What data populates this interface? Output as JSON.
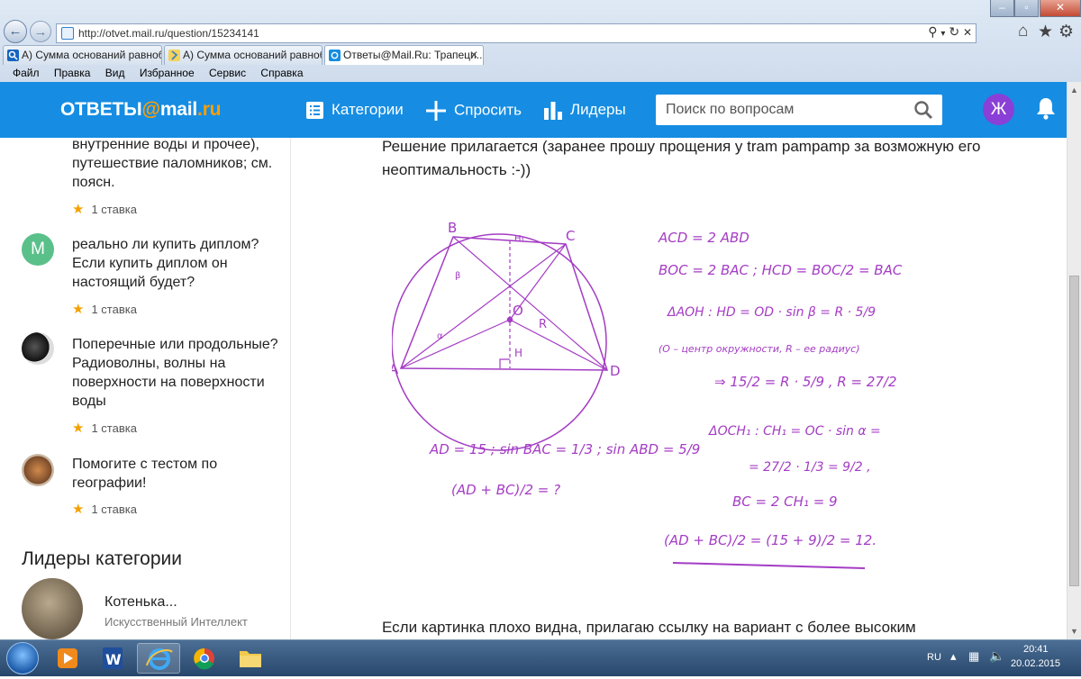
{
  "browser": {
    "url": "http://otvet.mail.ru/question/15234141",
    "tabs": [
      {
        "label": "А) Сумма оснований равноб..."
      },
      {
        "label": "А) Сумма оснований равноб..."
      },
      {
        "label": "Ответы@Mail.Ru: Трапеци..."
      }
    ],
    "menu": [
      "Файл",
      "Правка",
      "Вид",
      "Избранное",
      "Сервис",
      "Справка"
    ]
  },
  "site": {
    "logo_main": "ОТВЕТЫ",
    "logo_at": "@",
    "logo_mail": "mail",
    "logo_dot": ".",
    "logo_ru": "ru",
    "nav": {
      "categories": "Категории",
      "ask": "Спросить",
      "leaders": "Лидеры"
    },
    "search_placeholder": "Поиск по вопросам",
    "avatar_letter": "Ж",
    "accent": "#168de2"
  },
  "sidebar": {
    "questions": [
      {
        "text": "внутренние воды и прочее), путешествие паломников; см. поясн.",
        "stakes": "1 ставка"
      },
      {
        "avatar_letter": "М",
        "text": "реально ли купить диплом? Если купить диплом он настоящий будет?",
        "stakes": "1 ставка"
      },
      {
        "text": "Поперечные или продольные? Радиоволны, волны на поверхности на поверхности воды",
        "stakes": "1 ставка"
      },
      {
        "text": "Помогите с тестом по географии!",
        "stakes": "1 ставка"
      }
    ],
    "leaders_title": "Лидеры категории",
    "leader": {
      "name": "Котенька...",
      "status": "Искусственный Интеллект"
    }
  },
  "main": {
    "answer_text": "Решение прилагается (заранее прошу прощения у tram pampamp за возможную его неоптимальность :-))",
    "footer_text": "Если картинка плохо видна, прилагаю ссылку на вариант с более высоким",
    "solution": {
      "labels": {
        "B": "B",
        "C": "C",
        "A": "A",
        "D": "D",
        "O": "O",
        "H": "H",
        "H1": "H₁",
        "R": "R",
        "beta": "β",
        "alpha": "α"
      },
      "lines": [
        "ACD = 2 ABD",
        "BOC = 2 BAC ;  HCD = BOC/2 = BAC",
        "ΔAOH :  HD = OD · sin β = R · 5/9",
        "(O – центр окружности, R – ее радиус)",
        "⇒ 15/2 = R · 5/9 ,  R = 27/2",
        "ΔOCH₁ :  CH₁ = OC · sin α =",
        "= 27/2 · 1/3 = 9/2 ,",
        "BC = 2 CH₁ = 9",
        "(AD + BC)/2 = (15 + 9)/2 = 12."
      ],
      "given": "AD = 15 ;  sin BAC = 1/3 ;  sin ABD = 5/9",
      "question": "(AD + BC)/2 = ?"
    }
  },
  "taskbar": {
    "lang": "RU",
    "time": "20:41",
    "date": "20.02.2015"
  }
}
